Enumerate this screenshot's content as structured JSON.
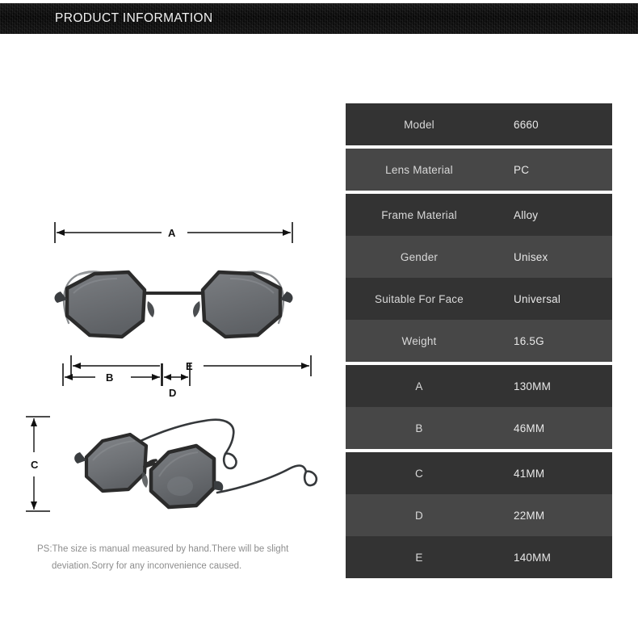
{
  "header": {
    "title": "PRODUCT INFORMATION"
  },
  "diagrams": {
    "front_view": {
      "name": "sunglasses-front-view",
      "dimension_labels": {
        "a": "A",
        "b": "B",
        "d": "D"
      }
    },
    "angled_view": {
      "name": "sunglasses-angled-view",
      "dimension_labels": {
        "e": "E",
        "c": "C"
      }
    }
  },
  "spec_table": {
    "rows": [
      {
        "label": "Model",
        "value": "6660",
        "shade": "dark",
        "gap_after": true
      },
      {
        "label": "Lens Material",
        "value": "PC",
        "shade": "light",
        "gap_after": true
      },
      {
        "label": "Frame Material",
        "value": "Alloy",
        "shade": "dark",
        "gap_after": false
      },
      {
        "label": "Gender",
        "value": "Unisex",
        "shade": "light",
        "gap_after": false
      },
      {
        "label": "Suitable For Face",
        "value": "Universal",
        "shade": "dark",
        "gap_after": false
      },
      {
        "label": "Weight",
        "value": "16.5G",
        "shade": "light",
        "gap_after": true
      },
      {
        "label": "A",
        "value": "130MM",
        "shade": "dark",
        "gap_after": false
      },
      {
        "label": "B",
        "value": "46MM",
        "shade": "light",
        "gap_after": true
      },
      {
        "label": "C",
        "value": "41MM",
        "shade": "dark",
        "gap_after": false
      },
      {
        "label": "D",
        "value": "22MM",
        "shade": "light",
        "gap_after": false
      },
      {
        "label": "E",
        "value": "140MM",
        "shade": "dark",
        "gap_after": false
      }
    ]
  },
  "footnote": {
    "line1": "PS:The size is manual measured by hand.There will be slight",
    "line2": "deviation.Sorry for any inconvenience caused."
  },
  "colors": {
    "banner_background": "#0a0a0a",
    "banner_text": "#f2f2f2",
    "row_dark": "#333333",
    "row_light": "#474747",
    "row_label_text": "#d8d8d8",
    "row_value_text": "#e8e8e8",
    "footnote_text": "#8d8d8d",
    "dimension_line": "#111111",
    "lens_tint": "#6e7175",
    "frame_metal": "#2b2b2b"
  }
}
